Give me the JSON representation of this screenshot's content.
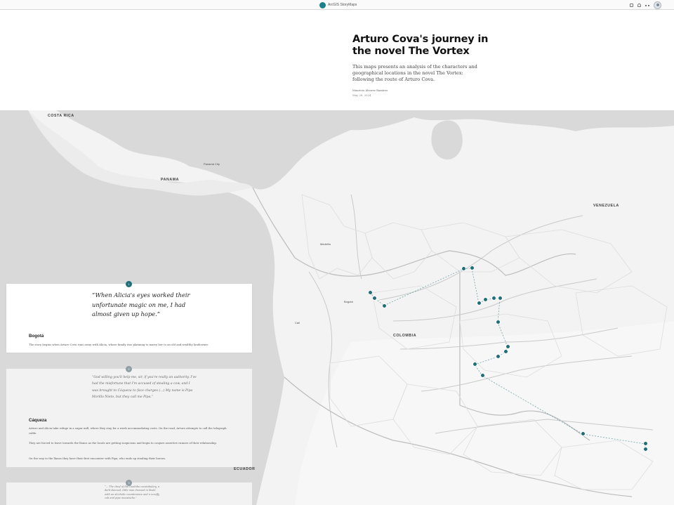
{
  "app": {
    "brand": "ArcGIS StoryMaps"
  },
  "story": {
    "title": "Arturo Cova's journey in the novel The Vortex",
    "summary": "This maps presents an analysis of the characters and geographical locations in the novel The Vortex: following the route of Arturo Cova.",
    "author": "Mauricio Álvarez Ramírez",
    "date": "May 28, 2024"
  },
  "map": {
    "labels": {
      "costa_rica": "COSTA RICA",
      "panama": "PANAMA",
      "colombia": "COLOMBIA",
      "venezuela": "VENEZUELA",
      "ecuador": "ECUADOR",
      "bogota": "Bogotá",
      "medellin": "Medellín",
      "cali": "Cali",
      "panama_city": "Panamá City"
    },
    "marker_color": "#1f6f7a"
  },
  "cards": [
    {
      "number": "1",
      "quote": "“When Alicia's eyes worked their unfortunate magic on me, I had almost given up hope.”",
      "heading": "Bogotá",
      "text": "The story begins when Arturo Cova runs away with Alicia, whose family was planning to marry her to an old and wealthy landowner."
    },
    {
      "number": "2",
      "quote": "“God willing you'll help me, sir, if you're really an authority. I've had the misfortune that I'm accused of stealing a cow, and I was brought to Cáqueza to face charges (...) My name is Pipa Morillo Nieto, but they call me Pipa.”",
      "heading": "Cáqueza",
      "text1": "Arturo and Alicia take refuge in a sugar mill, where they stay for a week accommodating costs. On the road, Arturo attempts to call the telegraph cable.",
      "text2": "They are forced to leave towards the llanos as the locals are getting suspicious and begin to conjure assertive rumors of their relationship.",
      "text3": "On the way to the llanos they have their first encounter with Pipa, who ends up stealing their horses."
    },
    {
      "number": "3",
      "quote": "“... The chief of the Guahibo constabulary, a dark-skinned, little man dressed in khaki with an alcoholic countenance and a scruffy cob and pipe moustache.”"
    }
  ]
}
